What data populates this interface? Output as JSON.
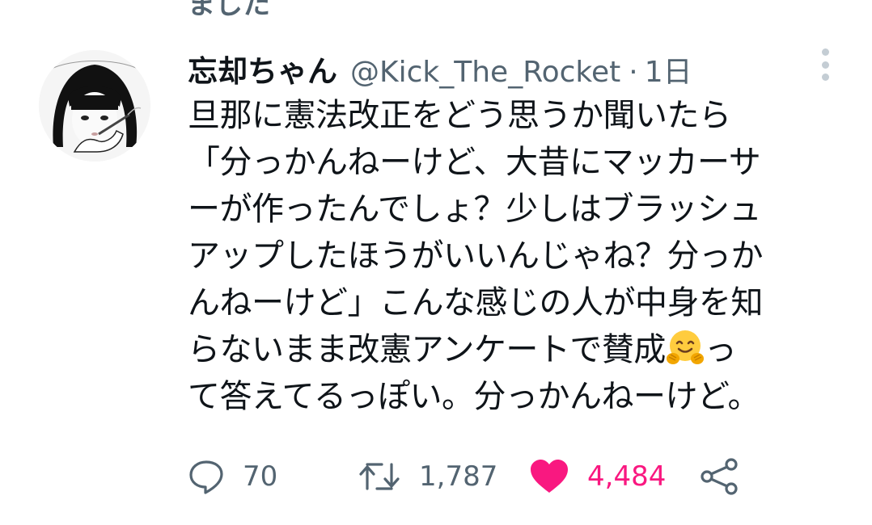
{
  "previous_tweet_fragment": "ました",
  "tweet": {
    "author": {
      "display_name": "忘却ちゃん",
      "handle": "@Kick_The_Rocket",
      "avatar_icon": "avatar-illustration"
    },
    "separator": "·",
    "timestamp": "1日",
    "more_icon": "more-vertical-icon",
    "lines": [
      "旦那に憲法改正をどう思うか聞いたら",
      "「分っかんねーけど、大昔にマッカーサ",
      "ーが作ったんでしょ？少しはブラッシュ",
      "アップしたほうがいいんじゃね？分っか",
      "んねーけど」こんな感じの人が中身を知"
    ],
    "line6_before_emoji": "らないまま改憲アンケートで賛成",
    "emoji_icon": "hugging-face-emoji",
    "line6_after_emoji": "っ",
    "line7": "て答えてるっぽい。分っかんねーけど。"
  },
  "actions": {
    "reply": {
      "icon": "reply-icon",
      "count": "70"
    },
    "retweet": {
      "icon": "retweet-icon",
      "count": "1,787"
    },
    "like": {
      "icon": "heart-icon",
      "count": "4,484",
      "active": true,
      "color": "#f91880"
    },
    "share": {
      "icon": "share-icon"
    }
  },
  "colors": {
    "text_primary": "#0f1419",
    "text_secondary": "#536471",
    "like_active": "#f91880"
  }
}
